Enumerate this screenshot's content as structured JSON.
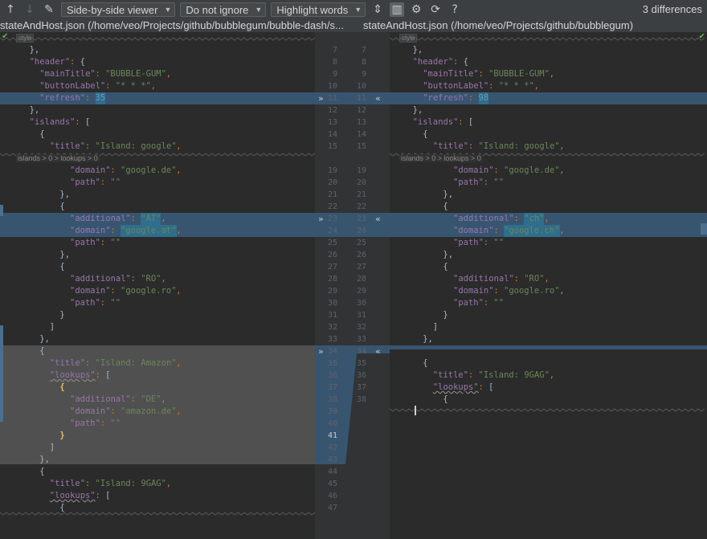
{
  "toolbar": {
    "viewer": "Side-by-side viewer",
    "ignore": "Do not ignore",
    "highlight": "Highlight words",
    "diff_count": "3 differences",
    "icons": [
      "arrow-up-icon",
      "arrow-down-icon",
      "edit-icon",
      "collapse-icon",
      "side-by-side-icon",
      "settings-icon",
      "sync-scroll-icon",
      "help-icon"
    ]
  },
  "titles": {
    "left": "stateAndHost.json (/home/veo/Projects/github/bubblegum/bubble-dash/s...",
    "right": "stateAndHost.json (/home/veo/Projects/github/bubblegum)"
  },
  "labels": {
    "style": "style",
    "breadcrumb": "islands > 0 > lookups > 0"
  },
  "gutter": {
    "left": [
      "7",
      "8",
      "9",
      "10",
      "11",
      "12",
      "13",
      "14",
      "15",
      "19",
      "20",
      "21",
      "22",
      "23",
      "24",
      "25",
      "26",
      "27",
      "28",
      "29",
      "30",
      "31",
      "32",
      "33",
      "34",
      "35",
      "36",
      "37",
      "38",
      "39",
      "40",
      "41",
      "42",
      "43",
      "44",
      "45",
      "46",
      "47"
    ],
    "right": [
      "7",
      "8",
      "9",
      "10",
      "11",
      "12",
      "13",
      "14",
      "15",
      "19",
      "20",
      "21",
      "22",
      "23",
      "24",
      "25",
      "26",
      "27",
      "28",
      "29",
      "30",
      "31",
      "32",
      "33",
      "34",
      "35",
      "36",
      "37",
      "38"
    ]
  },
  "left_code": [
    {
      "i": 2,
      "parts": [
        [
          "plain",
          "},"
        ]
      ]
    },
    {
      "i": 2,
      "parts": [
        [
          "key",
          "\"header\""
        ],
        [
          "punc",
          ": "
        ],
        [
          "plain",
          "{"
        ]
      ]
    },
    {
      "i": 4,
      "parts": [
        [
          "key",
          "\"mainTitle\""
        ],
        [
          "punc",
          ": "
        ],
        [
          "str",
          "\"BUBBLE-GUM\""
        ],
        [
          "punc",
          ","
        ]
      ]
    },
    {
      "i": 4,
      "parts": [
        [
          "key",
          "\"buttonLabel\""
        ],
        [
          "punc",
          ": "
        ],
        [
          "str",
          "\"* * *\""
        ],
        [
          "punc",
          ","
        ]
      ]
    },
    {
      "i": 4,
      "parts": [
        [
          "key",
          "\"refresh\""
        ],
        [
          "punc",
          ": "
        ],
        [
          "num",
          "35"
        ]
      ]
    },
    {
      "i": 2,
      "parts": [
        [
          "plain",
          "},"
        ]
      ]
    },
    {
      "i": 2,
      "parts": [
        [
          "key",
          "\"islands\""
        ],
        [
          "punc",
          ": "
        ],
        [
          "plain",
          "["
        ]
      ]
    },
    {
      "i": 4,
      "parts": [
        [
          "plain",
          "{"
        ]
      ]
    },
    {
      "i": 6,
      "parts": [
        [
          "key",
          "\"title\""
        ],
        [
          "punc",
          ": "
        ],
        [
          "str",
          "\"Island: google\""
        ],
        [
          "punc",
          ","
        ]
      ]
    },
    {
      "i": 10,
      "parts": [
        [
          "key",
          "\"domain\""
        ],
        [
          "punc",
          ": "
        ],
        [
          "str",
          "\"google.de\""
        ],
        [
          "punc",
          ","
        ]
      ]
    },
    {
      "i": 10,
      "parts": [
        [
          "key",
          "\"path\""
        ],
        [
          "punc",
          ": "
        ],
        [
          "str",
          "\"\""
        ]
      ]
    },
    {
      "i": 8,
      "parts": [
        [
          "plain",
          "},"
        ]
      ]
    },
    {
      "i": 8,
      "parts": [
        [
          "plain",
          "{"
        ]
      ]
    },
    {
      "i": 10,
      "parts": [
        [
          "key",
          "\"additional\""
        ],
        [
          "punc",
          ": "
        ],
        [
          "str",
          "\"AT\""
        ],
        [
          "punc",
          ","
        ]
      ]
    },
    {
      "i": 10,
      "parts": [
        [
          "key",
          "\"domain\""
        ],
        [
          "punc",
          ": "
        ],
        [
          "str",
          "\"google.at\""
        ],
        [
          "punc",
          ","
        ]
      ]
    },
    {
      "i": 10,
      "parts": [
        [
          "key",
          "\"path\""
        ],
        [
          "punc",
          ": "
        ],
        [
          "str",
          "\"\""
        ]
      ]
    },
    {
      "i": 8,
      "parts": [
        [
          "plain",
          "},"
        ]
      ]
    },
    {
      "i": 8,
      "parts": [
        [
          "plain",
          "{"
        ]
      ]
    },
    {
      "i": 10,
      "parts": [
        [
          "key",
          "\"additional\""
        ],
        [
          "punc",
          ": "
        ],
        [
          "str",
          "\"RO\""
        ],
        [
          "punc",
          ","
        ]
      ]
    },
    {
      "i": 10,
      "parts": [
        [
          "key",
          "\"domain\""
        ],
        [
          "punc",
          ": "
        ],
        [
          "str",
          "\"google.ro\""
        ],
        [
          "punc",
          ","
        ]
      ]
    },
    {
      "i": 10,
      "parts": [
        [
          "key",
          "\"path\""
        ],
        [
          "punc",
          ": "
        ],
        [
          "str",
          "\"\""
        ]
      ]
    },
    {
      "i": 8,
      "parts": [
        [
          "plain",
          "}"
        ]
      ]
    },
    {
      "i": 6,
      "parts": [
        [
          "plain",
          "]"
        ]
      ]
    },
    {
      "i": 4,
      "parts": [
        [
          "plain",
          "},"
        ]
      ]
    },
    {
      "i": 4,
      "parts": [
        [
          "plain",
          "{"
        ]
      ]
    },
    {
      "i": 6,
      "parts": [
        [
          "key",
          "\"title\""
        ],
        [
          "punc",
          ": "
        ],
        [
          "str",
          "\"Island: Amazon\""
        ],
        [
          "punc",
          ","
        ]
      ]
    },
    {
      "i": 6,
      "parts": [
        [
          "key",
          "\"lookups\""
        ],
        [
          "punc",
          ": "
        ],
        [
          "plain",
          "["
        ]
      ]
    },
    {
      "i": 8,
      "parts": [
        [
          "plain",
          "{"
        ]
      ]
    },
    {
      "i": 10,
      "parts": [
        [
          "key",
          "\"additional\""
        ],
        [
          "punc",
          ": "
        ],
        [
          "str",
          "\"DE\""
        ],
        [
          "punc",
          ","
        ]
      ]
    },
    {
      "i": 10,
      "parts": [
        [
          "key",
          "\"domain\""
        ],
        [
          "punc",
          ": "
        ],
        [
          "str",
          "\"amazon.de\""
        ],
        [
          "punc",
          ","
        ]
      ]
    },
    {
      "i": 10,
      "parts": [
        [
          "key",
          "\"path\""
        ],
        [
          "punc",
          ": "
        ],
        [
          "str",
          "\"\""
        ]
      ]
    },
    {
      "i": 8,
      "parts": [
        [
          "plain",
          "}"
        ]
      ]
    },
    {
      "i": 6,
      "parts": [
        [
          "plain",
          "]"
        ]
      ]
    },
    {
      "i": 4,
      "parts": [
        [
          "plain",
          "},"
        ]
      ]
    },
    {
      "i": 4,
      "parts": [
        [
          "plain",
          "{"
        ]
      ]
    },
    {
      "i": 6,
      "parts": [
        [
          "key",
          "\"title\""
        ],
        [
          "punc",
          ": "
        ],
        [
          "str",
          "\"Island: 9GAG\""
        ],
        [
          "punc",
          ","
        ]
      ]
    },
    {
      "i": 6,
      "parts": [
        [
          "key",
          "\"lookups\""
        ],
        [
          "punc",
          ": "
        ],
        [
          "plain",
          "["
        ]
      ]
    },
    {
      "i": 8,
      "parts": [
        [
          "plain",
          "{"
        ]
      ]
    }
  ],
  "right_code": [
    {
      "i": 2,
      "parts": [
        [
          "plain",
          "},"
        ]
      ]
    },
    {
      "i": 2,
      "parts": [
        [
          "key",
          "\"header\""
        ],
        [
          "punc",
          ": "
        ],
        [
          "plain",
          "{"
        ]
      ]
    },
    {
      "i": 4,
      "parts": [
        [
          "key",
          "\"mainTitle\""
        ],
        [
          "punc",
          ": "
        ],
        [
          "str",
          "\"BUBBLE-GUM\""
        ],
        [
          "punc",
          ","
        ]
      ]
    },
    {
      "i": 4,
      "parts": [
        [
          "key",
          "\"buttonLabel\""
        ],
        [
          "punc",
          ": "
        ],
        [
          "str",
          "\"* * *\""
        ],
        [
          "punc",
          ","
        ]
      ]
    },
    {
      "i": 4,
      "parts": [
        [
          "key",
          "\"refresh\""
        ],
        [
          "punc",
          ": "
        ],
        [
          "num",
          "98"
        ]
      ]
    },
    {
      "i": 2,
      "parts": [
        [
          "plain",
          "},"
        ]
      ]
    },
    {
      "i": 2,
      "parts": [
        [
          "key",
          "\"islands\""
        ],
        [
          "punc",
          ": "
        ],
        [
          "plain",
          "["
        ]
      ]
    },
    {
      "i": 4,
      "parts": [
        [
          "plain",
          "{"
        ]
      ]
    },
    {
      "i": 6,
      "parts": [
        [
          "key",
          "\"title\""
        ],
        [
          "punc",
          ": "
        ],
        [
          "str",
          "\"Island: google\""
        ],
        [
          "punc",
          ","
        ]
      ]
    },
    {
      "i": 10,
      "parts": [
        [
          "key",
          "\"domain\""
        ],
        [
          "punc",
          ": "
        ],
        [
          "str",
          "\"google.de\""
        ],
        [
          "punc",
          ","
        ]
      ]
    },
    {
      "i": 10,
      "parts": [
        [
          "key",
          "\"path\""
        ],
        [
          "punc",
          ": "
        ],
        [
          "str",
          "\"\""
        ]
      ]
    },
    {
      "i": 8,
      "parts": [
        [
          "plain",
          "},"
        ]
      ]
    },
    {
      "i": 8,
      "parts": [
        [
          "plain",
          "{"
        ]
      ]
    },
    {
      "i": 10,
      "parts": [
        [
          "key",
          "\"additional\""
        ],
        [
          "punc",
          ": "
        ],
        [
          "str",
          "\"ch\""
        ],
        [
          "punc",
          ","
        ]
      ]
    },
    {
      "i": 10,
      "parts": [
        [
          "key",
          "\"domain\""
        ],
        [
          "punc",
          ": "
        ],
        [
          "str",
          "\"google.ch\""
        ],
        [
          "punc",
          ","
        ]
      ]
    },
    {
      "i": 10,
      "parts": [
        [
          "key",
          "\"path\""
        ],
        [
          "punc",
          ": "
        ],
        [
          "str",
          "\"\""
        ]
      ]
    },
    {
      "i": 8,
      "parts": [
        [
          "plain",
          "},"
        ]
      ]
    },
    {
      "i": 8,
      "parts": [
        [
          "plain",
          "{"
        ]
      ]
    },
    {
      "i": 10,
      "parts": [
        [
          "key",
          "\"additional\""
        ],
        [
          "punc",
          ": "
        ],
        [
          "str",
          "\"RO\""
        ],
        [
          "punc",
          ","
        ]
      ]
    },
    {
      "i": 10,
      "parts": [
        [
          "key",
          "\"domain\""
        ],
        [
          "punc",
          ": "
        ],
        [
          "str",
          "\"google.ro\""
        ],
        [
          "punc",
          ","
        ]
      ]
    },
    {
      "i": 10,
      "parts": [
        [
          "key",
          "\"path\""
        ],
        [
          "punc",
          ": "
        ],
        [
          "str",
          "\"\""
        ]
      ]
    },
    {
      "i": 8,
      "parts": [
        [
          "plain",
          "}"
        ]
      ]
    },
    {
      "i": 6,
      "parts": [
        [
          "plain",
          "]"
        ]
      ]
    },
    {
      "i": 4,
      "parts": [
        [
          "plain",
          "},"
        ]
      ]
    },
    {
      "i": 0,
      "parts": []
    },
    {
      "i": 4,
      "parts": [
        [
          "plain",
          "{"
        ]
      ]
    },
    {
      "i": 6,
      "parts": [
        [
          "key",
          "\"title\""
        ],
        [
          "punc",
          ": "
        ],
        [
          "str",
          "\"Island: 9GAG\""
        ],
        [
          "punc",
          ","
        ]
      ]
    },
    {
      "i": 6,
      "parts": [
        [
          "key",
          "\"lookups\""
        ],
        [
          "punc",
          ": "
        ],
        [
          "plain",
          "["
        ]
      ]
    },
    {
      "i": 8,
      "parts": [
        [
          "plain",
          "{"
        ]
      ]
    }
  ]
}
